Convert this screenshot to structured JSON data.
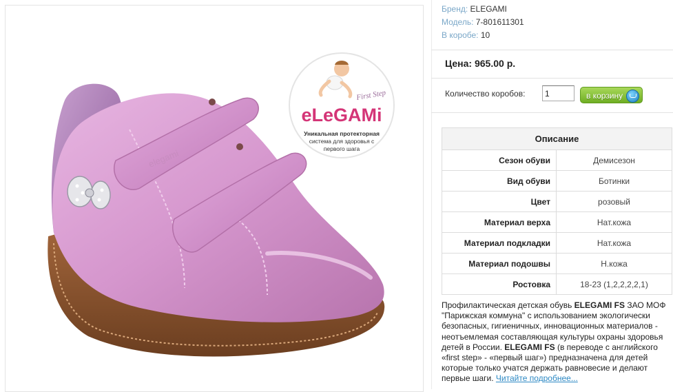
{
  "product": {
    "brand_label": "Бренд:",
    "brand": "ELEGAMI",
    "model_label": "Модель:",
    "model": "7-801611301",
    "box_label": "В коробе:",
    "box_count": "10",
    "price_label": "Цена:",
    "price": "965.00 р."
  },
  "logo": {
    "tagline_first_step": "First Step",
    "brand_text": "eLeGAMi",
    "caption_line1": "Уникальная протекторная",
    "caption_line2": "система для здоровья с",
    "caption_line3": "первого шага"
  },
  "order": {
    "qty_label": "Количество коробов:",
    "qty_value": "1",
    "cart_button": "в корзину"
  },
  "description": {
    "title": "Описание",
    "rows": [
      {
        "key": "Сезон обуви",
        "value": "Демисезон"
      },
      {
        "key": "Вид обуви",
        "value": "Ботинки"
      },
      {
        "key": "Цвет",
        "value": "розовый"
      },
      {
        "key": "Материал верха",
        "value": "Нат.кожа"
      },
      {
        "key": "Материал подкладки",
        "value": "Нат.кожа"
      },
      {
        "key": "Материал подошвы",
        "value": "Н.кожа"
      },
      {
        "key": "Ростовка",
        "value": "18-23 (1,2,2,2,2,1)"
      }
    ],
    "text_p1": "Профилактическая детская обувь ",
    "text_b1": "ELEGAMI FS",
    "text_p2": " ЗАО МОФ \"Парижская коммуна\" с использованием экологически безопасных, гигиеничных, инновационных материалов - неотъемлемая составляющая культуры охраны здоровья детей в России. ",
    "text_b2": "ELEGAMI FS",
    "text_p3": " (в переводе с английского «first step» - «первый шаг») предназначена для детей которые только учатся держать равновесие и делают первые шаги.  ",
    "read_more": "Читайте подробнее..."
  },
  "colors": {
    "label_blue": "#7aa7c8",
    "button_green": "#6fae23",
    "shoe_pink": "#d79ad0",
    "link_blue": "#2d89c4"
  }
}
